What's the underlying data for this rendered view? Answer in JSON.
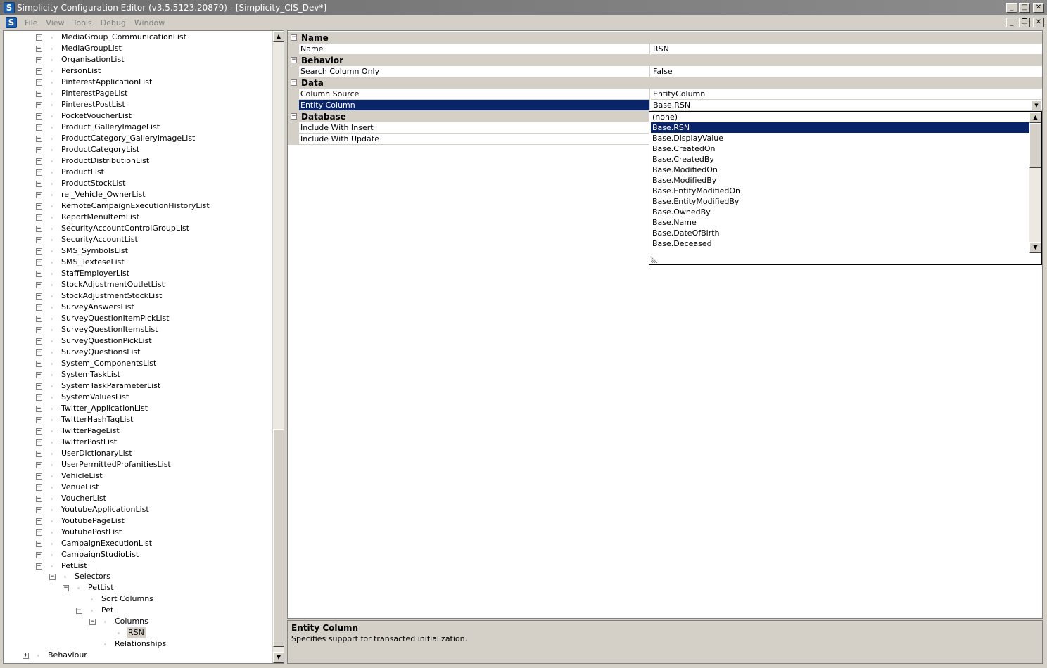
{
  "window": {
    "title": "Simplicity Configuration Editor (v3.5.5123.20879) - [Simplicity_CIS_Dev*]",
    "app_icon_letter": "S",
    "minimize": "_",
    "maximize": "□",
    "close": "✕",
    "restore": "❐"
  },
  "menu": [
    "File",
    "View",
    "Tools",
    "Debug",
    "Window"
  ],
  "tree": {
    "lists": [
      "MediaGroup_CommunicationList",
      "MediaGroupList",
      "OrganisationList",
      "PersonList",
      "PinterestApplicationList",
      "PinterestPageList",
      "PinterestPostList",
      "PocketVoucherList",
      "Product_GalleryImageList",
      "ProductCategory_GalleryImageList",
      "ProductCategoryList",
      "ProductDistributionList",
      "ProductList",
      "ProductStockList",
      "rel_Vehicle_OwnerList",
      "RemoteCampaignExecutionHistoryList",
      "ReportMenuItemList",
      "SecurityAccountControlGroupList",
      "SecurityAccountList",
      "SMS_SymbolsList",
      "SMS_TexteseList",
      "StaffEmployerList",
      "StockAdjustmentOutletList",
      "StockAdjustmentStockList",
      "SurveyAnswersList",
      "SurveyQuestionItemPickList",
      "SurveyQuestionItemsList",
      "SurveyQuestionPickList",
      "SurveyQuestionsList",
      "System_ComponentsList",
      "SystemTaskList",
      "SystemTaskParameterList",
      "SystemValuesList",
      "Twitter_ApplicationList",
      "TwitterHashTagList",
      "TwitterPageList",
      "TwitterPostList",
      "UserDictionaryList",
      "UserPermittedProfanitiesList",
      "VehicleList",
      "VenueList",
      "VoucherList",
      "YoutubeApplicationList",
      "YoutubePageList",
      "YoutubePostList",
      "CampaignExecutionList",
      "CampaignStudioList",
      "PetList"
    ],
    "selectors": "Selectors",
    "selector_petlist": "PetList",
    "sort_columns": "Sort Columns",
    "pet": "Pet",
    "columns": "Columns",
    "rsn": "RSN",
    "relationships": "Relationships",
    "behaviour": "Behaviour",
    "expand_glyph": "+",
    "collapse_glyph": "−"
  },
  "properties": {
    "categories": {
      "name": "Name",
      "behavior": "Behavior",
      "data": "Data",
      "database": "Database"
    },
    "name_label": "Name",
    "name_value": "RSN",
    "search_column_only_label": "Search Column Only",
    "search_column_only_value": "False",
    "column_source_label": "Column Source",
    "column_source_value": "EntityColumn",
    "entity_column_label": "Entity Column",
    "entity_column_value": "Base.RSN",
    "include_with_insert_label": "Include With Insert",
    "include_with_update_label": "Include With Update"
  },
  "dropdown": {
    "items": [
      "(none)",
      "Base.RSN",
      "Base.DisplayValue",
      "Base.CreatedOn",
      "Base.CreatedBy",
      "Base.ModifiedOn",
      "Base.ModifiedBy",
      "Base.EntityModifiedOn",
      "Base.EntityModifiedBy",
      "Base.OwnedBy",
      "Base.Name",
      "Base.DateOfBirth",
      "Base.Deceased"
    ],
    "selected_index": 1
  },
  "description": {
    "title": "Entity Column",
    "text": "Specifies support for transacted initialization."
  },
  "colors": {
    "selection": "#0a246a",
    "chrome": "#d4d0c8",
    "titlebar": "#7a7a7a"
  }
}
